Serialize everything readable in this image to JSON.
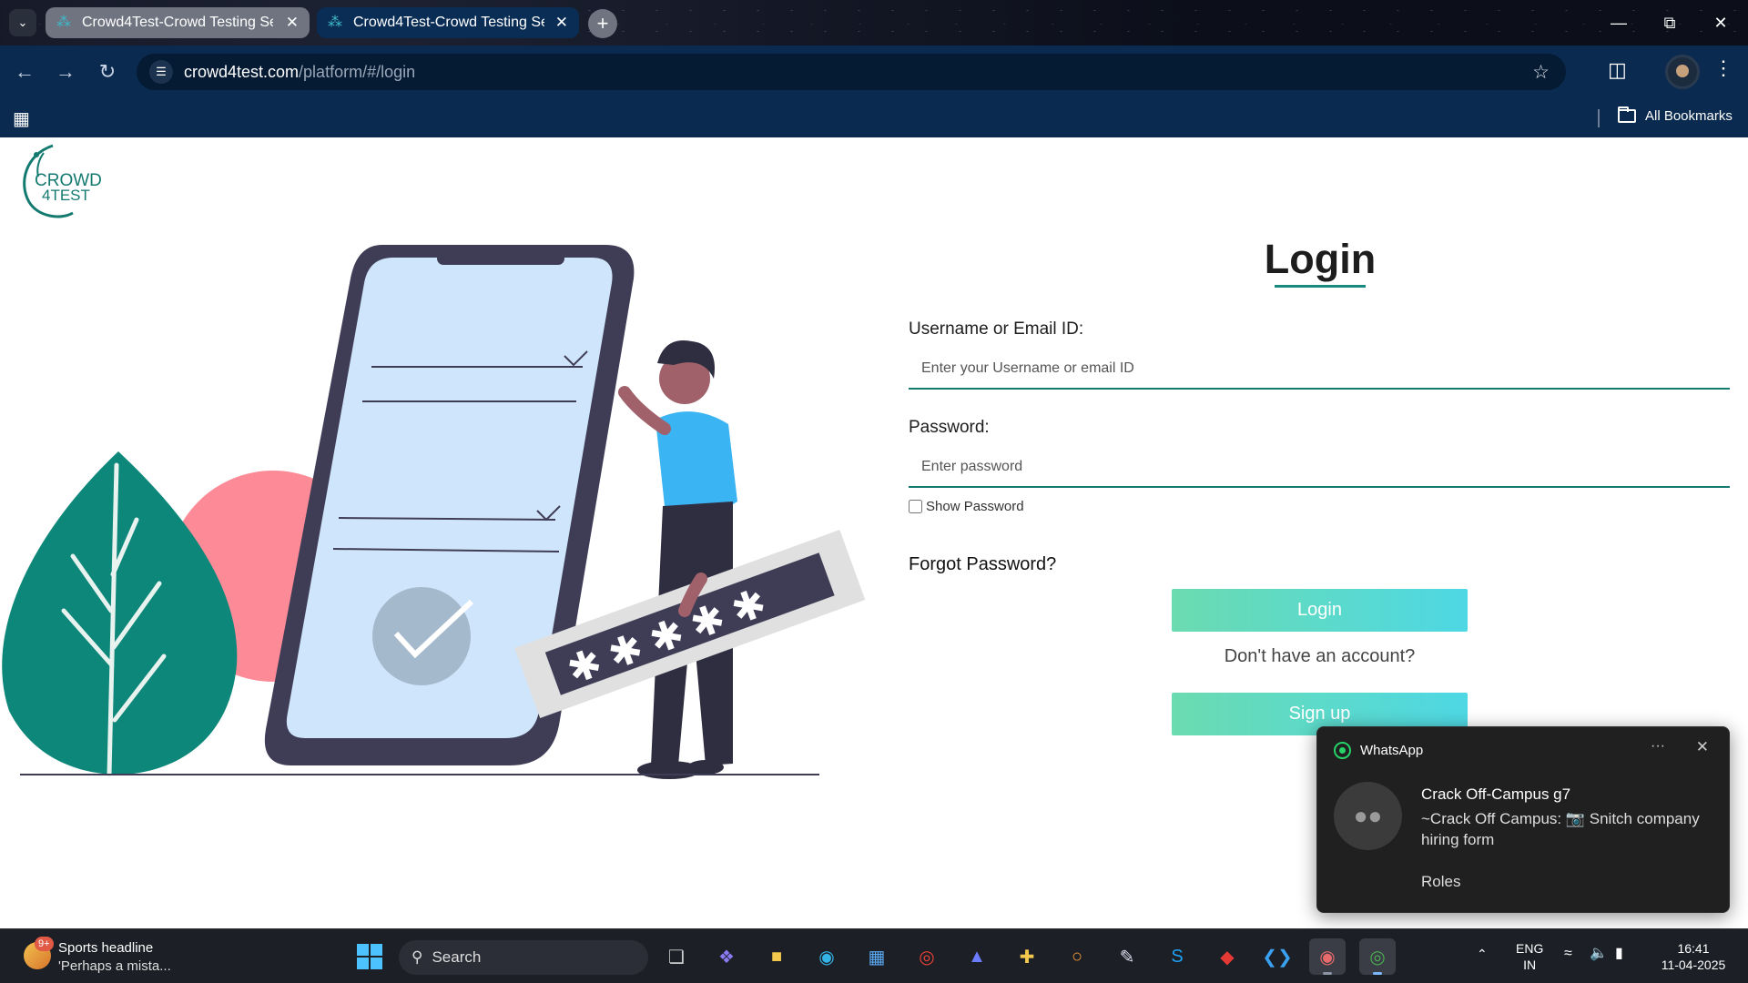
{
  "browser": {
    "tabs": [
      {
        "title": "Crowd4Test-Crowd Testing Serv",
        "active": false
      },
      {
        "title": "Crowd4Test-Crowd Testing Serv",
        "active": true
      }
    ],
    "url_host": "crowd4test.com",
    "url_path": "/platform/#/login",
    "bookmarks_label": "All Bookmarks"
  },
  "logo": {
    "line1": "CROWD",
    "line2": "4TEST"
  },
  "login": {
    "title": "Login",
    "username_label": "Username or Email ID:",
    "username_placeholder": "Enter your Username or email ID",
    "password_label": "Password:",
    "password_placeholder": "Enter password",
    "show_password_label": "Show Password",
    "forgot_label": "Forgot Password?",
    "login_button": "Login",
    "no_account_text": "Don't have an account?",
    "signup_button": "Sign up"
  },
  "notification": {
    "app": "WhatsApp",
    "more": "···",
    "title": "Crack Off-Campus g7",
    "message": "~Crack Off Campus: 📷 Snitch company hiring form",
    "footer": "Roles"
  },
  "taskbar": {
    "weather_badge": "9+",
    "weather_line1": "Sports headline",
    "weather_line2": "'Perhaps a mista...",
    "search_label": "Search",
    "lang_line1": "ENG",
    "lang_line2": "IN",
    "time": "16:41",
    "date": "11-04-2025"
  },
  "colors": {
    "accent_teal": "#137a70",
    "button_gradient_start": "#6bdbb0",
    "button_gradient_end": "#4ed8e4",
    "chrome_dark": "#0a2a4f"
  }
}
